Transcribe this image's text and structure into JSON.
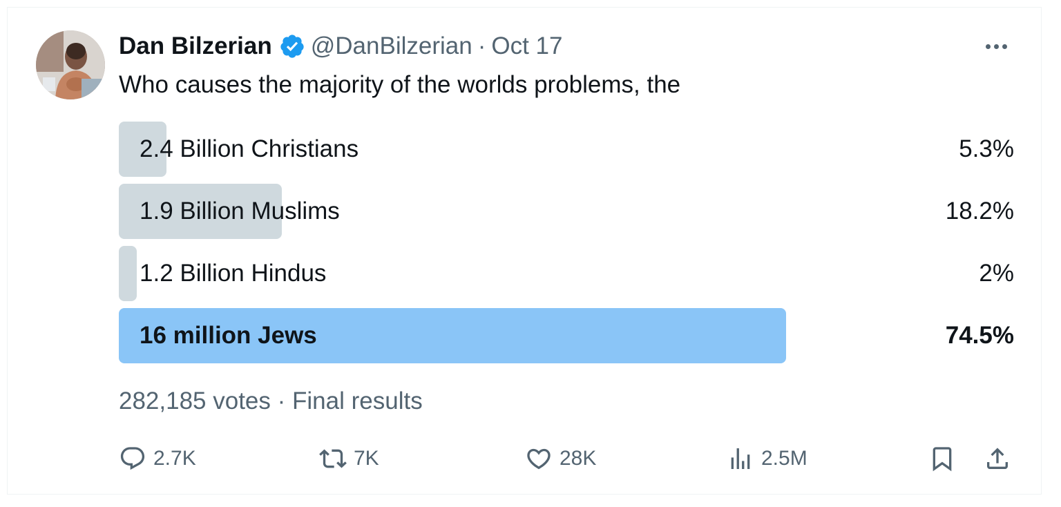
{
  "author": {
    "name": "Dan Bilzerian",
    "handle": "@DanBilzerian",
    "separator": "·",
    "date": "Oct 17"
  },
  "tweet": {
    "text": "Who causes the majority of the worlds problems, the"
  },
  "poll": {
    "options": [
      {
        "label": "2.4 Billion Christians",
        "percent_text": "5.3%",
        "percent": 5.3,
        "winner": false
      },
      {
        "label": "1.9 Billion Muslims",
        "percent_text": "18.2%",
        "percent": 18.2,
        "winner": false
      },
      {
        "label": "1.2 Billion Hindus",
        "percent_text": "2%",
        "percent": 2,
        "winner": false
      },
      {
        "label": "16 million Jews",
        "percent_text": "74.5%",
        "percent": 74.5,
        "winner": true
      }
    ],
    "votes": "282,185 votes",
    "separator": "·",
    "status": "Final results"
  },
  "actions": {
    "replies": "2.7K",
    "reposts": "7K",
    "likes": "28K",
    "views": "2.5M"
  },
  "icons": {
    "verified": "verified-badge-icon",
    "more": "more-horizontal-icon",
    "reply": "reply-bubble-icon",
    "repost": "repost-arrows-icon",
    "like": "heart-icon",
    "views": "analytics-bars-icon",
    "bookmark": "bookmark-icon",
    "share": "share-upload-icon"
  },
  "colors": {
    "text_primary": "#0f1419",
    "text_secondary": "#536471",
    "poll_bar": "#cfd9de",
    "poll_winner_bar": "#8ac5f7",
    "verified_blue": "#1d9bf0"
  }
}
